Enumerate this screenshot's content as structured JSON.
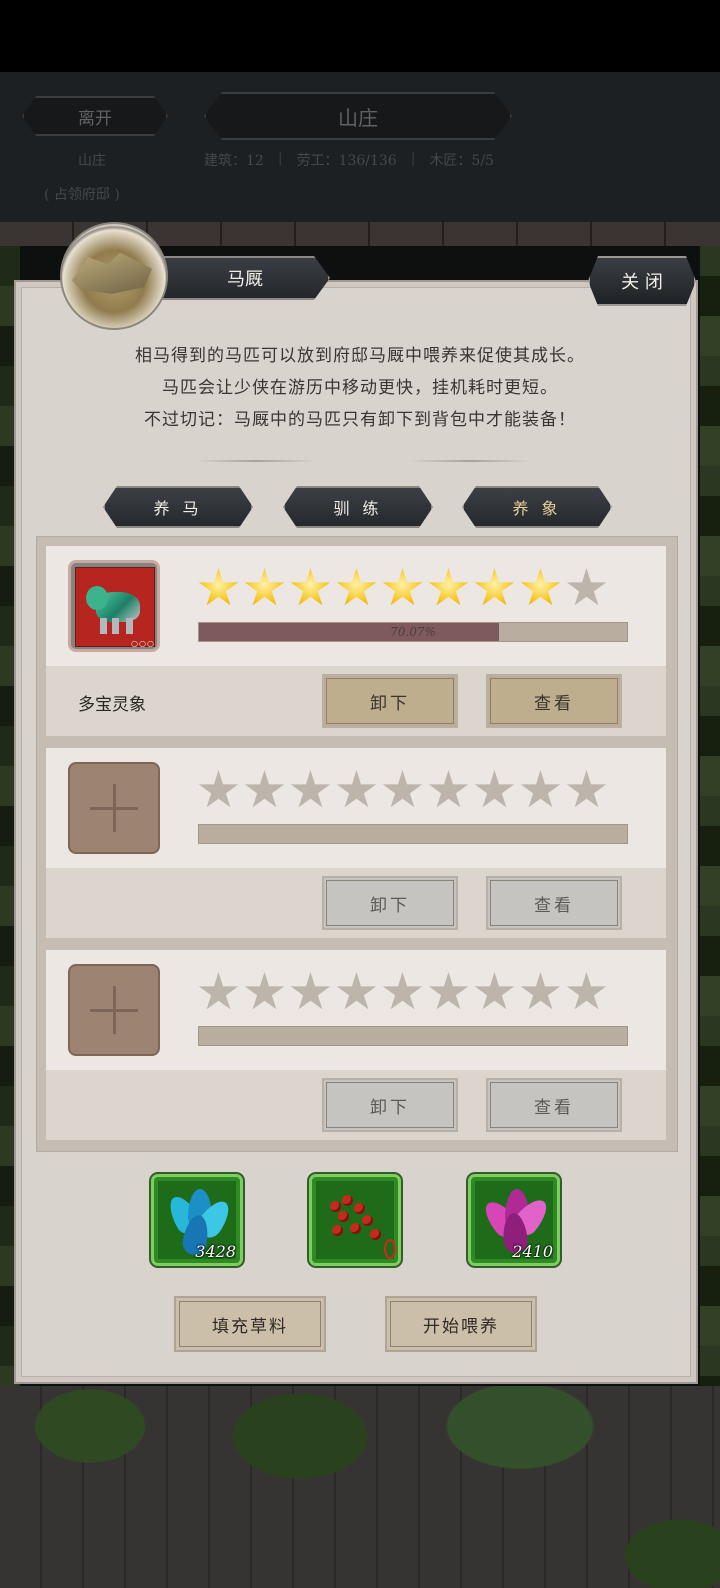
{
  "hud": {
    "leave_label": "离开",
    "title": "山庄",
    "subtitle_1": "山庄",
    "subtitle_2": "( 占领府邸 )",
    "stats": [
      "建筑：12",
      "劳工：136/136",
      "木匠：5/5"
    ]
  },
  "panel": {
    "title": "马厩",
    "close_label": "关 闭",
    "description": [
      "相马得到的马匹可以放到府邸马厩中喂养来促使其成长。",
      "马匹会让少侠在游历中移动更快，挂机耗时更短。",
      "不过切记：马厩中的马匹只有卸下到背包中才能装备！"
    ],
    "tabs": [
      {
        "label": "养 马",
        "active": false
      },
      {
        "label": "驯 练",
        "active": false
      },
      {
        "label": "养 象",
        "active": true
      }
    ]
  },
  "slots": [
    {
      "filled": true,
      "name": "多宝灵象",
      "stars_filled": 8,
      "stars_total": 9,
      "progress": 0.7007,
      "progress_label": "70.07%",
      "unload_label": "卸下",
      "view_label": "查看"
    },
    {
      "filled": false,
      "name": "",
      "stars_filled": 0,
      "stars_total": 9,
      "progress": 0,
      "unload_label": "卸下",
      "view_label": "查看"
    },
    {
      "filled": false,
      "name": "",
      "stars_filled": 0,
      "stars_total": 9,
      "progress": 0,
      "unload_label": "卸下",
      "view_label": "查看"
    }
  ],
  "feed_items": [
    {
      "icon": "blue-herb-icon",
      "count": "3428"
    },
    {
      "icon": "red-berries-icon",
      "count": ""
    },
    {
      "icon": "pink-herb-icon",
      "count": "2410"
    }
  ],
  "actions": {
    "fill_label": "填充草料",
    "feed_label": "开始喂养"
  },
  "colors": {
    "panel_bg": "#d9d3cd",
    "star_gold": "#f6c51c",
    "progress_fill": "#7e5a5f",
    "feed_bg": "#2f8a24"
  }
}
